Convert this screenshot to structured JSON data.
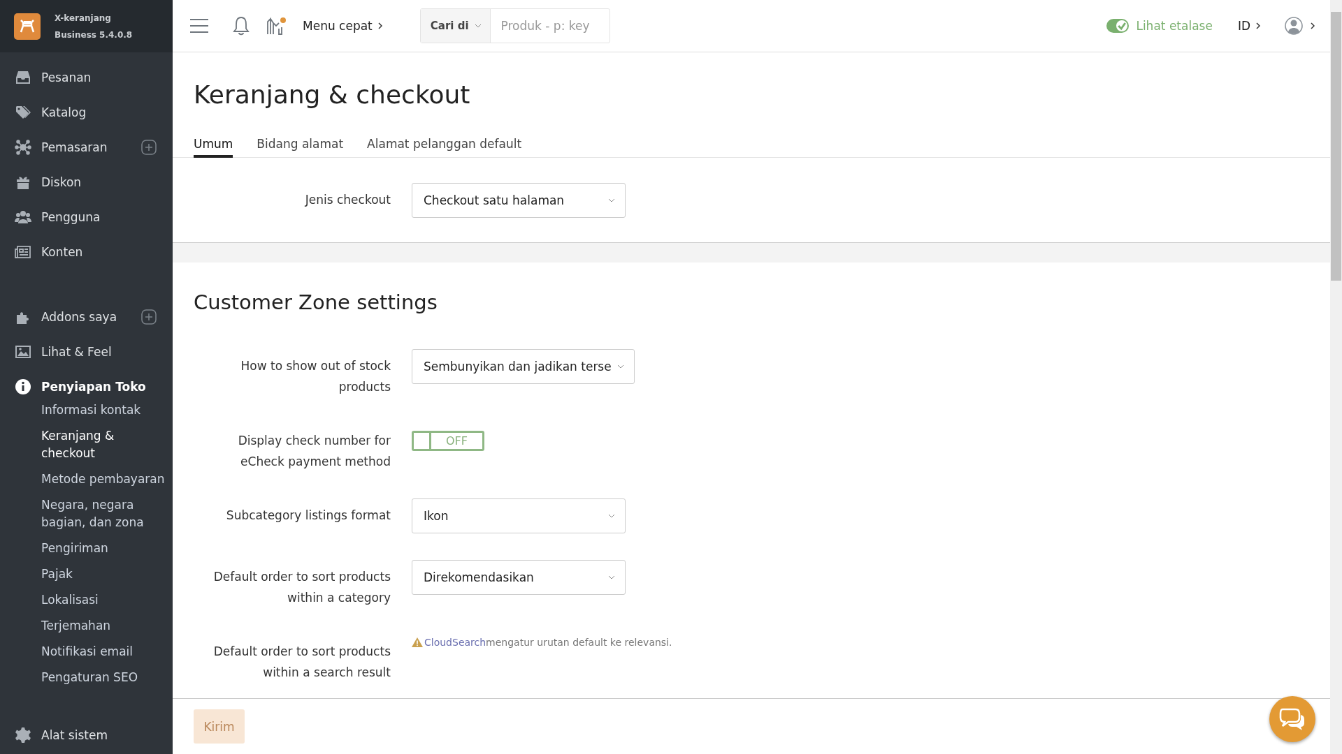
{
  "app": {
    "name": "X-keranjang",
    "version": "Business 5.4.0.8"
  },
  "topbar": {
    "quick_menu": "Menu cepat",
    "search": {
      "scope": "Cari di",
      "placeholder": "Produk - p: key"
    },
    "storefront": {
      "label": "Lihat etalase",
      "on": true
    },
    "language": "ID"
  },
  "sidebar": {
    "groups": [
      {
        "items": [
          {
            "label": "Pesanan",
            "add": false,
            "selected": false
          },
          {
            "label": "Katalog",
            "add": false,
            "selected": false
          },
          {
            "label": "Pemasaran",
            "add": true,
            "selected": false
          },
          {
            "label": "Diskon",
            "add": false,
            "selected": false
          },
          {
            "label": "Pengguna",
            "add": false,
            "selected": false
          },
          {
            "label": "Konten",
            "add": false,
            "selected": false
          }
        ]
      },
      {
        "items": [
          {
            "label": "Addons saya",
            "add": true,
            "selected": false
          },
          {
            "label": "Lihat & Feel",
            "add": false,
            "selected": false
          },
          {
            "label": "Penyiapan Toko",
            "add": false,
            "selected": true,
            "children": [
              {
                "label": "Informasi kontak",
                "selected": false
              },
              {
                "label": "Keranjang & checkout",
                "selected": true
              },
              {
                "label": "Metode pembayaran",
                "selected": false
              },
              {
                "label": "Negara, negara bagian, dan zona",
                "selected": false
              },
              {
                "label": "Pengiriman",
                "selected": false
              },
              {
                "label": "Pajak",
                "selected": false
              },
              {
                "label": "Lokalisasi",
                "selected": false
              },
              {
                "label": "Terjemahan",
                "selected": false
              },
              {
                "label": "Notifikasi email",
                "selected": false
              },
              {
                "label": "Pengaturan SEO",
                "selected": false
              }
            ]
          }
        ]
      },
      {
        "items": [
          {
            "label": "Alat sistem",
            "add": false,
            "selected": false
          }
        ]
      }
    ]
  },
  "page": {
    "title": "Keranjang & checkout",
    "tabs": [
      {
        "label": "Umum",
        "selected": true
      },
      {
        "label": "Bidang alamat",
        "selected": false
      },
      {
        "label": "Alamat pelanggan default",
        "selected": false
      }
    ],
    "general": [
      {
        "label": "Jenis checkout",
        "kind": "select",
        "value": "Checkout satu halaman"
      }
    ],
    "section_title": "Customer Zone settings",
    "settings": [
      {
        "label": "How to show out of stock products",
        "kind": "select",
        "value": "Sembunyikan dan jadikan terse"
      },
      {
        "label": "Display check number for eCheck payment method",
        "kind": "toggle",
        "on": false,
        "value": "OFF"
      },
      {
        "label": "Subcategory listings format",
        "kind": "select",
        "value": "Ikon"
      },
      {
        "label": "Default order to sort products within a category",
        "kind": "select",
        "value": "Direkomendasikan"
      },
      {
        "label": "Default order to sort products within a search result",
        "kind": "note",
        "link": "CloudSearch",
        "value": "mengatur urutan default ke relevansi."
      }
    ],
    "submit": {
      "label": "Kirim",
      "disabled": true
    }
  }
}
